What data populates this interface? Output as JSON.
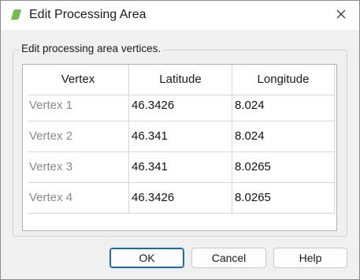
{
  "window": {
    "title": "Edit Processing Area",
    "icon": "green-leaf-icon"
  },
  "group": {
    "label": "Edit processing area vertices."
  },
  "table": {
    "headers": [
      "Vertex",
      "Latitude",
      "Longitude"
    ],
    "rows": [
      {
        "vertex": "Vertex 1",
        "latitude": "46.3426",
        "longitude": "8.024"
      },
      {
        "vertex": "Vertex 2",
        "latitude": "46.341",
        "longitude": "8.024"
      },
      {
        "vertex": "Vertex 3",
        "latitude": "46.341",
        "longitude": "8.0265"
      },
      {
        "vertex": "Vertex 4",
        "latitude": "46.3426",
        "longitude": "8.0265"
      }
    ]
  },
  "buttons": {
    "ok": "OK",
    "cancel": "Cancel",
    "help": "Help"
  },
  "colors": {
    "accent": "#0f6cbd",
    "icon_green": "#6cc04a",
    "row_header_text": "#8a8a8a"
  }
}
